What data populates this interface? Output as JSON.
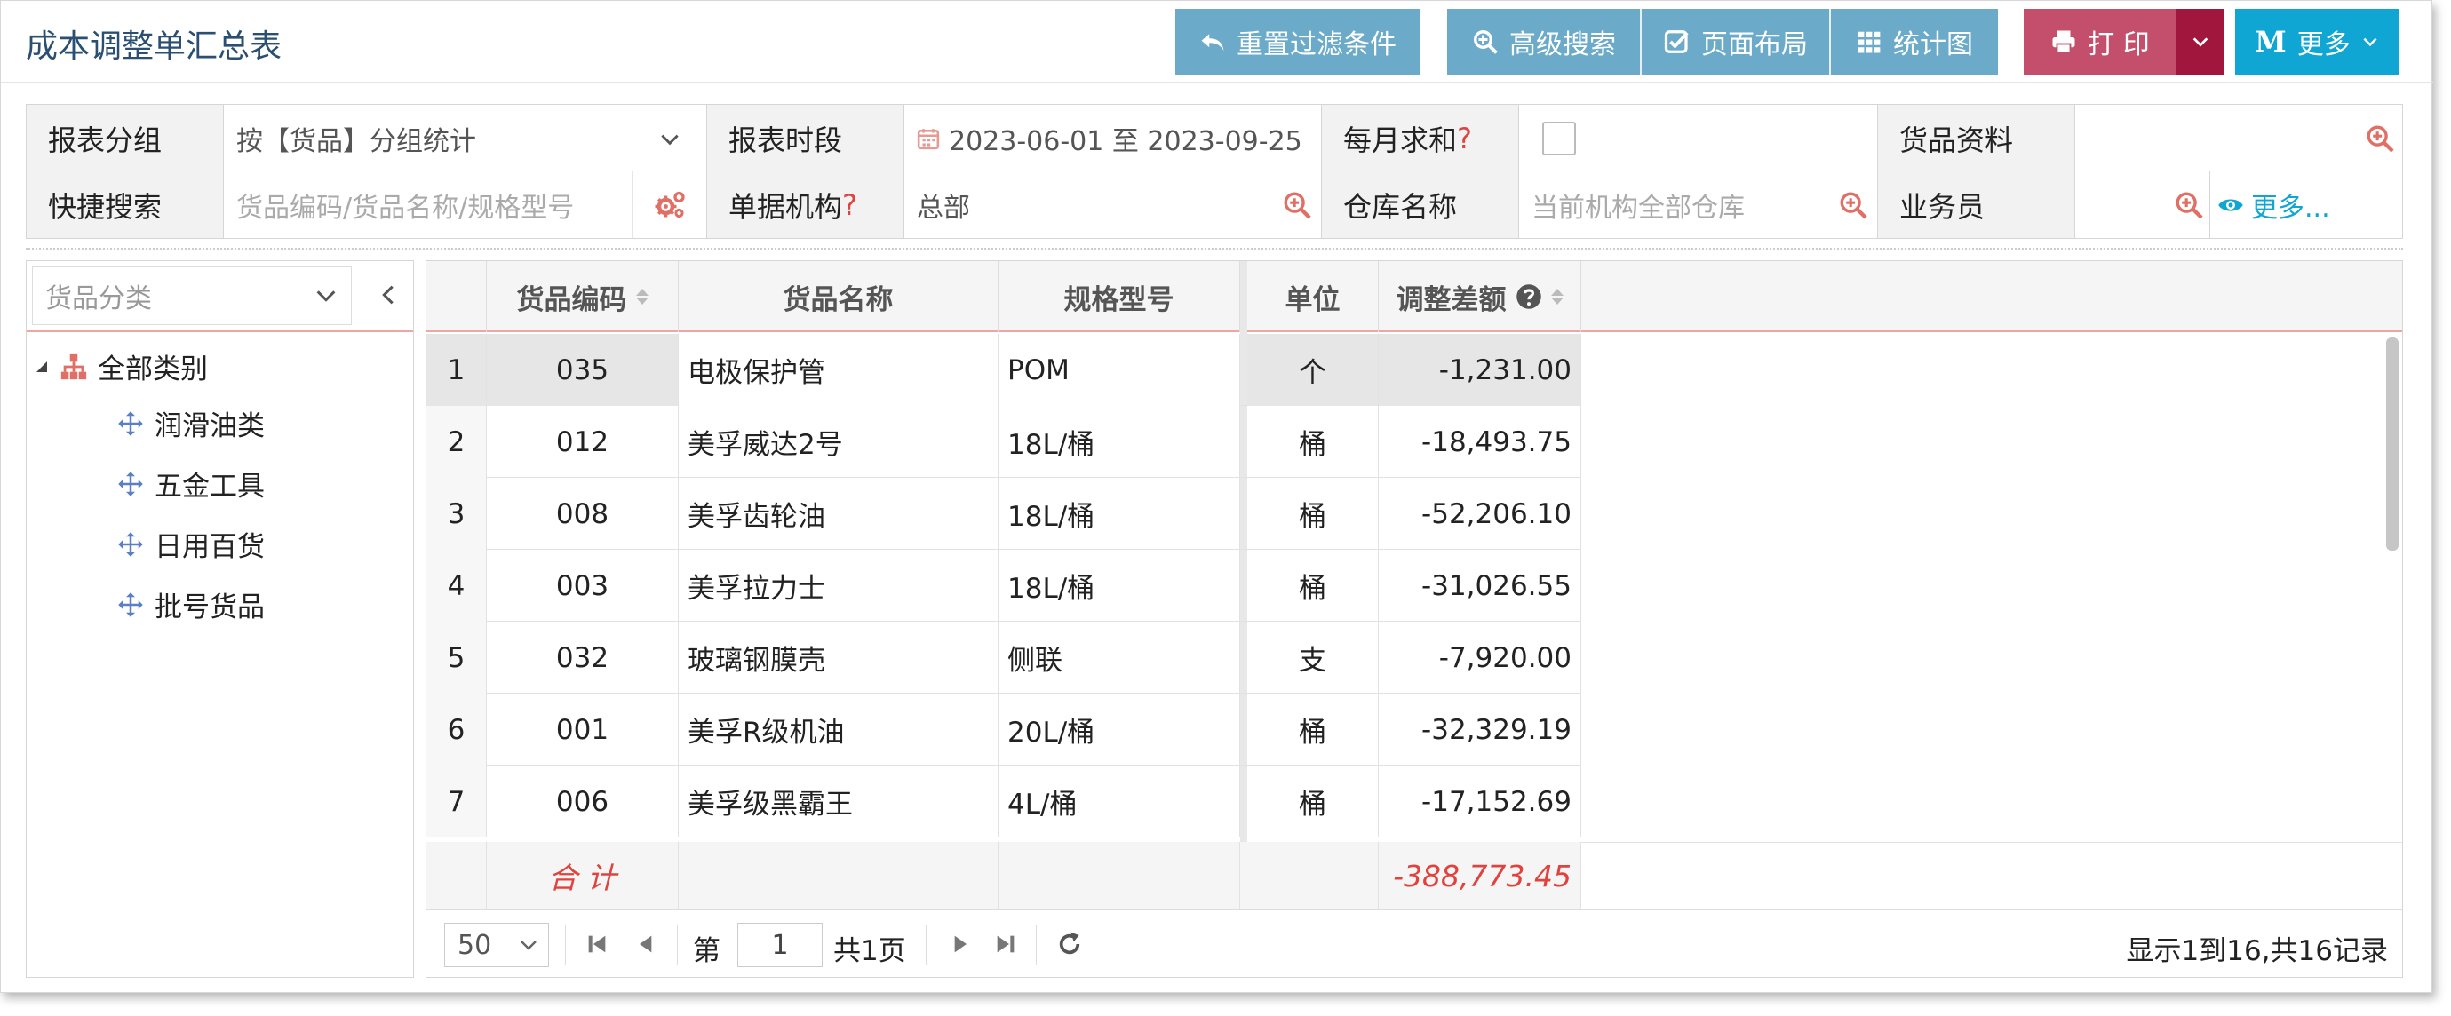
{
  "header": {
    "title": "成本调整单汇总表",
    "buttons": {
      "reset_filter": "重置过滤条件",
      "advanced_search": "高级搜索",
      "page_layout": "页面布局",
      "chart": "统计图",
      "print": "打 印",
      "more": "更多"
    },
    "more_badge": "M"
  },
  "filter": {
    "report_group_label": "报表分组",
    "report_group_value": "按【货品】分组统计",
    "period_label": "报表时段",
    "period_value": "2023-06-01 至 2023-09-25",
    "monthly_sum_label": "每月求和",
    "question_mark": "?",
    "goods_info_label": "货品资料",
    "quick_search_label": "快捷搜索",
    "quick_search_placeholder": "货品编码/货品名称/规格型号",
    "doc_org_label": "单据机构",
    "doc_org_value": "总部",
    "warehouse_label": "仓库名称",
    "warehouse_placeholder": "当前机构全部仓库",
    "salesman_label": "业务员",
    "more_link": "更多..."
  },
  "tree": {
    "selector_placeholder": "货品分类",
    "root": "全部类别",
    "items": [
      "润滑油类",
      "五金工具",
      "日用百货",
      "批号货品"
    ]
  },
  "grid": {
    "columns": {
      "code": "货品编码",
      "name": "货品名称",
      "spec": "规格型号",
      "unit": "单位",
      "diff": "调整差额"
    },
    "rows": [
      {
        "idx": "1",
        "code": "035",
        "name": "电极保护管",
        "spec": "POM",
        "unit": "个",
        "diff": "-1,231.00"
      },
      {
        "idx": "2",
        "code": "012",
        "name": "美孚威达2号",
        "spec": "18L/桶",
        "unit": "桶",
        "diff": "-18,493.75"
      },
      {
        "idx": "3",
        "code": "008",
        "name": "美孚齿轮油",
        "spec": "18L/桶",
        "unit": "桶",
        "diff": "-52,206.10"
      },
      {
        "idx": "4",
        "code": "003",
        "name": "美孚拉力士",
        "spec": "18L/桶",
        "unit": "桶",
        "diff": "-31,026.55"
      },
      {
        "idx": "5",
        "code": "032",
        "name": "玻璃钢膜壳",
        "spec": "侧联",
        "unit": "支",
        "diff": "-7,920.00"
      },
      {
        "idx": "6",
        "code": "001",
        "name": "美孚R级机油",
        "spec": "20L/桶",
        "unit": "桶",
        "diff": "-32,329.19"
      },
      {
        "idx": "7",
        "code": "006",
        "name": "美孚级黑霸王",
        "spec": "4L/桶",
        "unit": "桶",
        "diff": "-17,152.69"
      }
    ],
    "total_label": "合 计",
    "total_value": "-388,773.45"
  },
  "pager": {
    "page_size": "50",
    "page_prefix": "第",
    "current_page": "1",
    "page_suffix": "共1页",
    "info": "显示1到16,共16记录"
  },
  "colors": {
    "title": "#2a4f72",
    "btn_blue": "#6baac8",
    "btn_print": "#c44f6c",
    "btn_print_dropdown": "#a0163d",
    "btn_more": "#10a6d4",
    "accent_red": "#e0433e"
  }
}
